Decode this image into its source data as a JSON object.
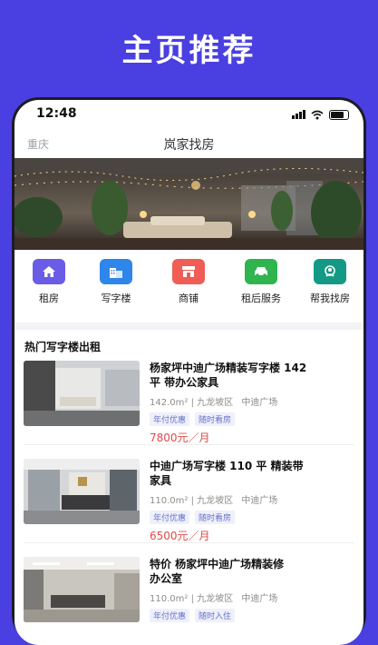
{
  "headline": "主页推荐",
  "status": {
    "time": "12:48"
  },
  "header": {
    "city": "重庆",
    "title": "岚家找房"
  },
  "quick": [
    {
      "label": "租房",
      "icon": "home-icon",
      "color": "#6b5ce7"
    },
    {
      "label": "写字楼",
      "icon": "office-building-icon",
      "color": "#2f86ea"
    },
    {
      "label": "商铺",
      "icon": "shop-icon",
      "color": "#ef5d55"
    },
    {
      "label": "租后服务",
      "icon": "car-icon",
      "color": "#2fb44f"
    },
    {
      "label": "帮我找房",
      "icon": "agent-icon",
      "color": "#149a84"
    }
  ],
  "section_title": "热门写字楼出租",
  "listings": [
    {
      "title_line1": "杨家坪中迪广场精装写字楼 142",
      "title_line2": "平 带办公家具",
      "area": "142.0m²",
      "district": "九龙坡区",
      "place": "中迪广场",
      "tags": [
        "年付优惠",
        "随时看房"
      ],
      "price": "7800元／月"
    },
    {
      "title_line1": "中迪广场写字楼 110 平 精装带",
      "title_line2": "家具",
      "area": "110.0m²",
      "district": "九龙坡区",
      "place": "中迪广场",
      "tags": [
        "年付优惠",
        "随时看房"
      ],
      "price": "6500元／月"
    },
    {
      "title_line1": "特价 杨家坪中迪广场精装修",
      "title_line2": "办公室",
      "area": "110.0m²",
      "district": "九龙坡区",
      "place": "中迪广场",
      "tags": [
        "年付优惠",
        "随时入住"
      ],
      "price": ""
    }
  ],
  "colors": {
    "background": "#4a3fe0",
    "price": "#e24a4a",
    "tag_text": "#6a73c9"
  }
}
